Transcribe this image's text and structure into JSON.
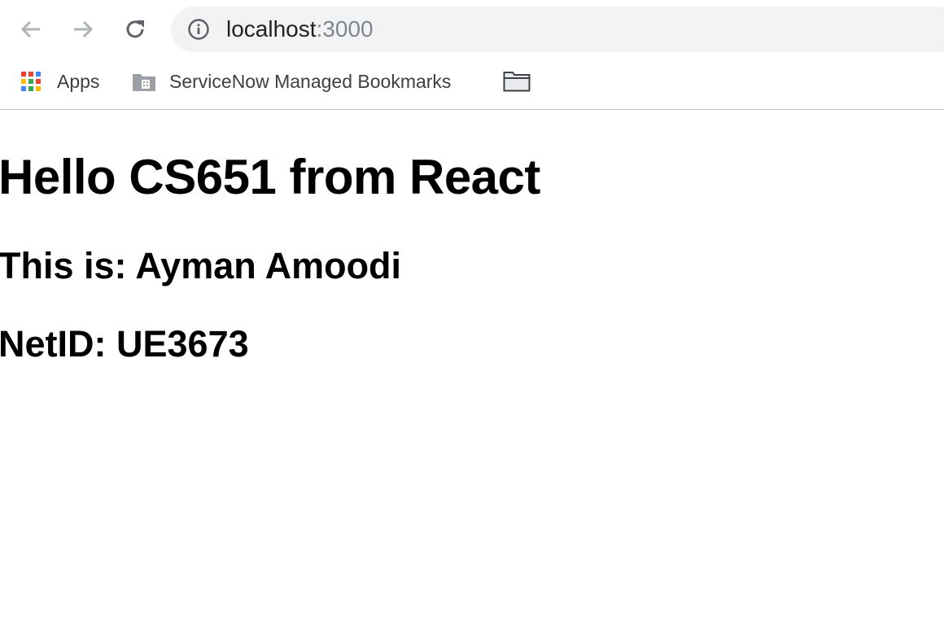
{
  "browser": {
    "nav": {
      "back_icon": "arrow-left-icon",
      "forward_icon": "arrow-right-icon",
      "reload_icon": "reload-icon"
    },
    "address_bar": {
      "host": "localhost",
      "port": ":3000",
      "info_icon": "info-circle-icon"
    },
    "bookmarks": [
      {
        "label": "Apps",
        "icon": "apps-grid-icon"
      },
      {
        "label": "ServiceNow Managed Bookmarks",
        "icon": "managed-folder-icon"
      },
      {
        "label": "",
        "icon": "folder-icon"
      }
    ]
  },
  "page": {
    "heading": "Hello CS651 from React",
    "name_line": "This is: Ayman Amoodi",
    "netid_line": "NetID: UE3673"
  },
  "colors": {
    "omnibox_bg": "#f1f3f4",
    "text": "#000000",
    "url_port": "#80868b"
  }
}
